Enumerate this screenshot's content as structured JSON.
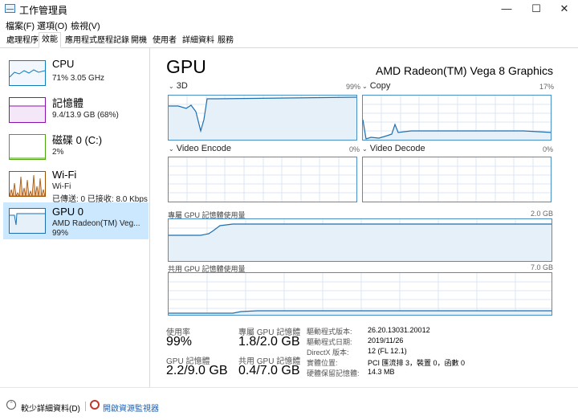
{
  "window": {
    "title": "工作管理員",
    "minimize": "—",
    "maximize": "☐",
    "close": "✕"
  },
  "menu": [
    "檔案(F)",
    "選項(O)",
    "檢視(V)"
  ],
  "tabs": [
    "處理程序",
    "效能",
    "應用程式歷程記錄",
    "開機",
    "使用者",
    "詳細資料",
    "服務"
  ],
  "active_tab": "效能",
  "sidebar": {
    "cpu": {
      "name": "CPU",
      "sub": "71%  3.05 GHz"
    },
    "memory": {
      "name": "記憶體",
      "sub": "9.4/13.9 GB (68%)"
    },
    "disk": {
      "name": "磁碟 0 (C:)",
      "sub": "2%"
    },
    "wifi": {
      "name": "Wi-Fi",
      "sub1": "Wi-Fi",
      "sub2": "已傳送: 0  已接收: 8.0 Kbps"
    },
    "gpu": {
      "name": "GPU 0",
      "sub1": "AMD Radeon(TM) Veg...",
      "sub2": "99%"
    }
  },
  "main": {
    "title": "GPU",
    "model": "AMD Radeon(TM) Vega 8 Graphics",
    "engines": [
      {
        "name": "3D",
        "value": "99%"
      },
      {
        "name": "Copy",
        "value": "17%"
      },
      {
        "name": "Video Encode",
        "value": "0%"
      },
      {
        "name": "Video Decode",
        "value": "0%"
      }
    ],
    "dedicated": {
      "label": "專屬 GPU 記憶體使用量",
      "max": "2.0 GB"
    },
    "shared": {
      "label": "共用 GPU 記憶體使用量",
      "max": "7.0 GB"
    }
  },
  "stats": {
    "utilization": {
      "label": "使用率",
      "value": "99%"
    },
    "dedicated_mem": {
      "label": "專屬 GPU 記憶體",
      "value": "1.8/2.0 GB"
    },
    "gpu_mem": {
      "label": "GPU 記憶體",
      "value": "2.2/9.0 GB"
    },
    "shared_mem": {
      "label": "共用 GPU 記憶體",
      "value": "0.4/7.0 GB"
    }
  },
  "info": [
    {
      "label": "驅動程式版本:",
      "value": "26.20.13031.20012"
    },
    {
      "label": "驅動程式日期:",
      "value": "2019/11/26"
    },
    {
      "label": "DirectX 版本:",
      "value": "12 (FL 12.1)"
    },
    {
      "label": "實體位置:",
      "value": "PCI 匯流排 3，裝置 0，函數 0"
    },
    {
      "label": "硬體保留記憶體:",
      "value": "14.3 MB"
    }
  ],
  "footer": {
    "fewer_details": "較少詳細資料(D)",
    "open_resmon": "開啟資源監視器"
  },
  "colors": {
    "gpu_line": "#1f6fb0",
    "gpu_fill": "#e6f0f9",
    "cpu_border": "#117dbb",
    "mem_border": "#8b12ae",
    "disk_border": "#4da60c",
    "wifi_border": "#a74f01",
    "selected_bg": "#cce8ff"
  }
}
